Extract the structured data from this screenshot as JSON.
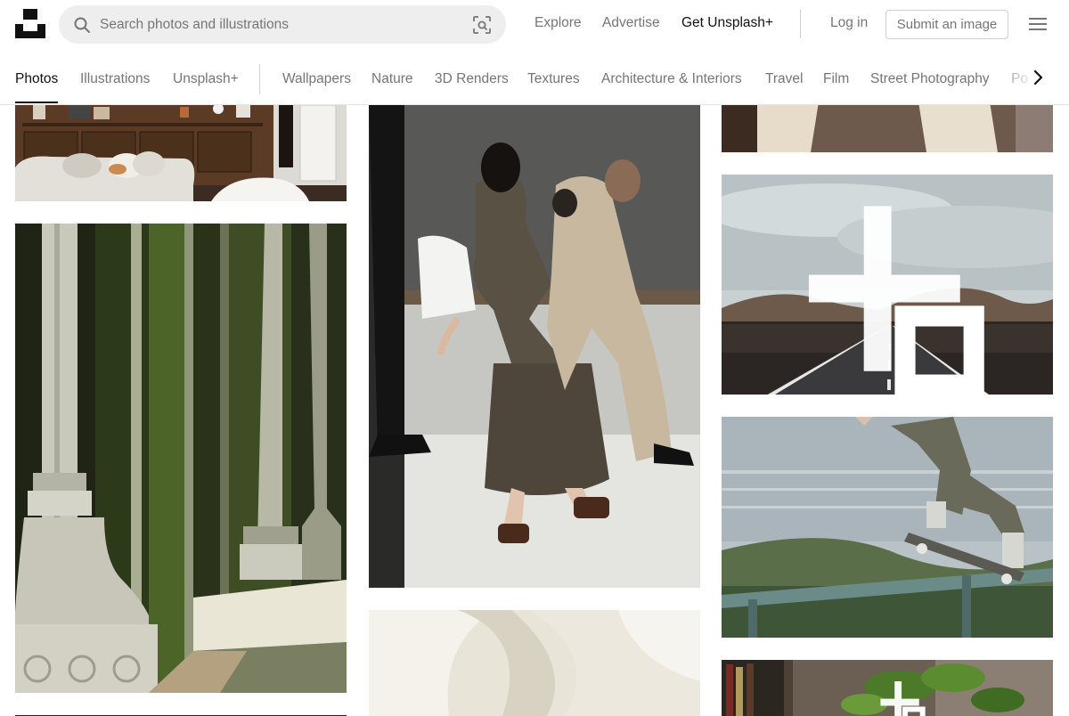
{
  "header": {
    "search_placeholder": "Search photos and illustrations",
    "nav": {
      "explore": "Explore",
      "advertise": "Advertise",
      "get_plus": "Get Unsplash+",
      "login": "Log in",
      "submit": "Submit an image"
    }
  },
  "tabs": {
    "primary": [
      "Photos",
      "Illustrations",
      "Unsplash+"
    ],
    "topics": [
      "Wallpapers",
      "Nature",
      "3D Renders",
      "Textures",
      "Architecture & Interiors",
      "Travel",
      "Film",
      "Street Photography",
      "Po"
    ],
    "active": "Photos"
  },
  "icons": {
    "search": "search-icon",
    "visual_search": "visual-search-icon",
    "menu": "hamburger-menu-icon",
    "scroll_right": "chevron-right-icon",
    "plus_badge": "unsplash-plus-icon"
  },
  "colors": {
    "text_primary": "#111111",
    "text_secondary": "#767676",
    "border": "#d1d1d1",
    "search_bg": "#eeeeee"
  }
}
